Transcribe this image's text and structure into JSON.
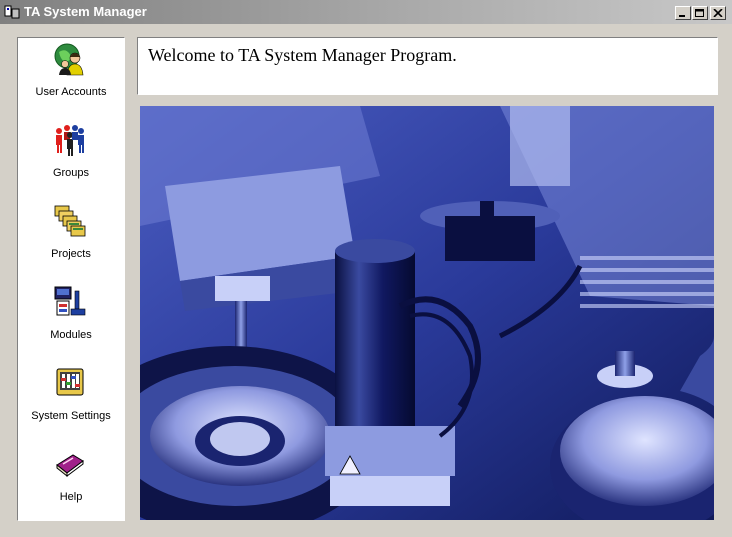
{
  "window": {
    "title": "TA System Manager"
  },
  "welcome": {
    "message": "Welcome to TA System Manager Program."
  },
  "sidebar": {
    "items": [
      {
        "label": "User Accounts",
        "icon": "user-accounts-icon"
      },
      {
        "label": "Groups",
        "icon": "groups-icon"
      },
      {
        "label": "Projects",
        "icon": "projects-icon"
      },
      {
        "label": "Modules",
        "icon": "modules-icon"
      },
      {
        "label": "System Settings",
        "icon": "system-settings-icon"
      },
      {
        "label": "Help",
        "icon": "help-book-icon"
      }
    ]
  },
  "colors": {
    "photo_tint": "#2a3a9a",
    "titlebar": "#9a9a9a"
  }
}
